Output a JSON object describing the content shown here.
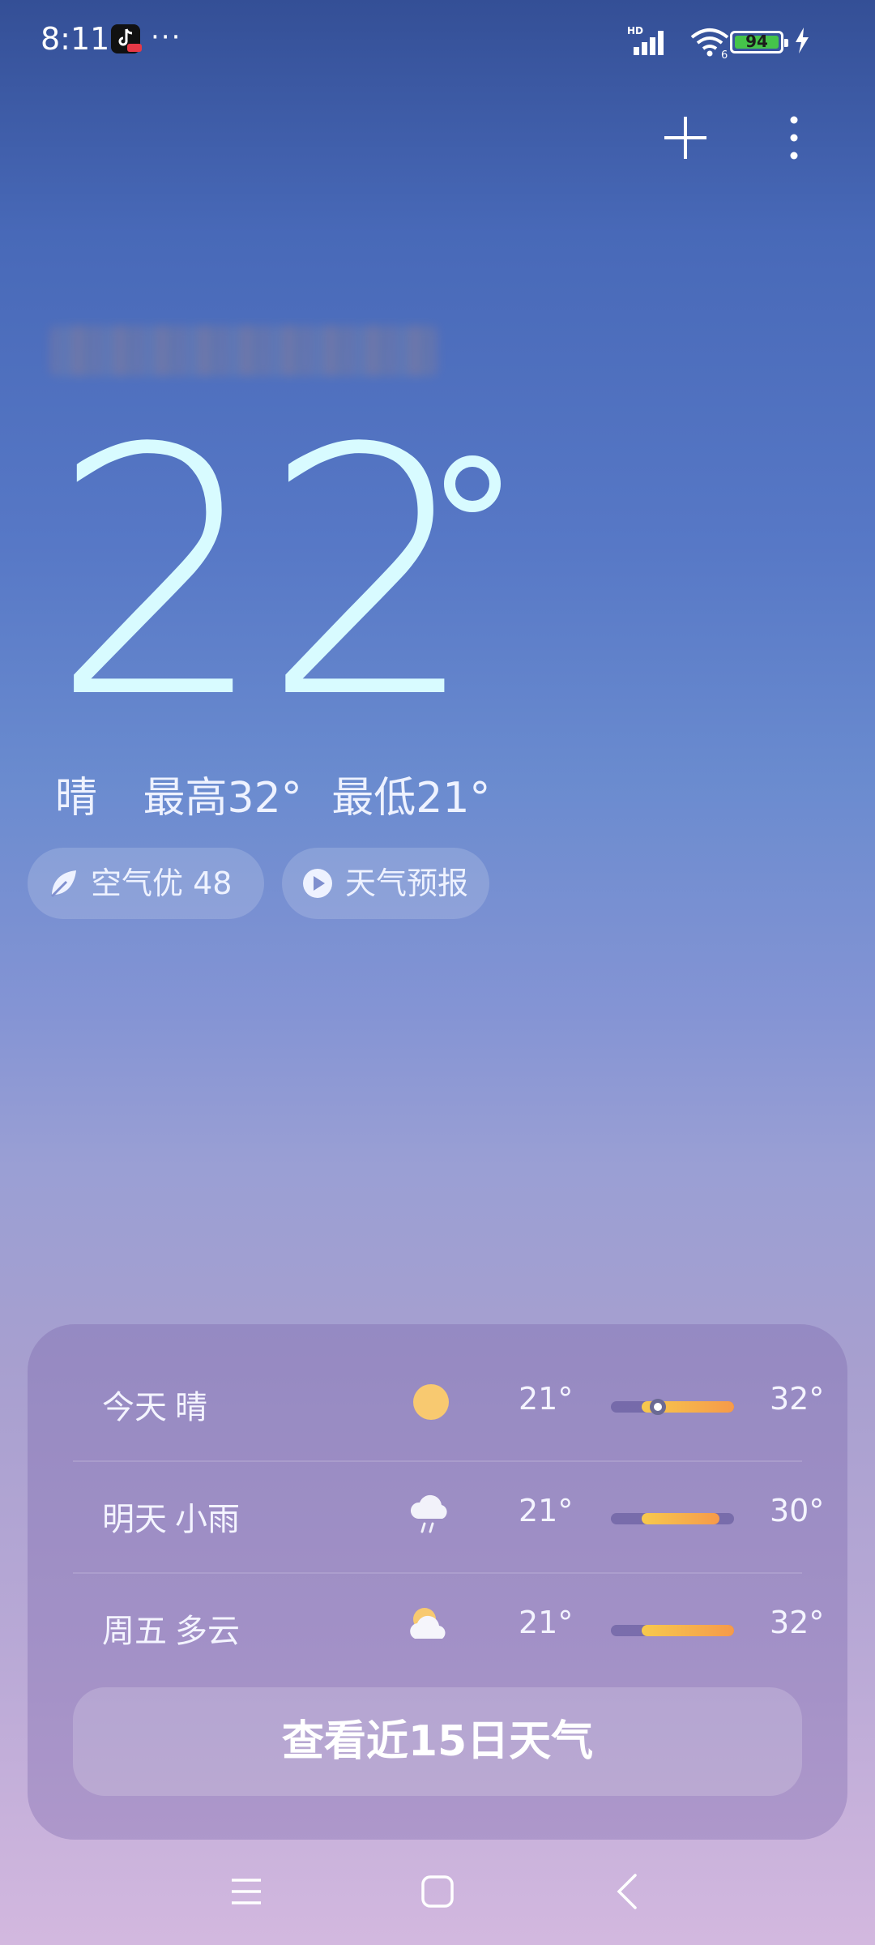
{
  "status_bar": {
    "time": "8:11",
    "more": "···",
    "battery": "94",
    "network_label": "HD",
    "wifi_label": "6"
  },
  "current": {
    "temperature": "22",
    "condition": "晴",
    "high": "最高32°",
    "low": "最低21°"
  },
  "pills": {
    "aqi": "空气优 48",
    "forecast": "天气预报"
  },
  "forecast": [
    {
      "day": "今天",
      "condition": "晴",
      "icon": "sun-icon",
      "low": "21°",
      "high": "32°",
      "bar_start": 0.25,
      "bar_end": 1.0,
      "now": 0.38
    },
    {
      "day": "明天",
      "condition": "小雨",
      "icon": "rain-cloud-icon",
      "low": "21°",
      "high": "30°",
      "bar_start": 0.25,
      "bar_end": 0.88
    },
    {
      "day": "周五",
      "condition": "多云",
      "icon": "partly-cloudy-icon",
      "low": "21°",
      "high": "32°",
      "bar_start": 0.25,
      "bar_end": 1.0
    }
  ],
  "view_15_days": "查看近15日天气",
  "colors": {
    "temp_text": "#d8fbff",
    "bar_warm": "#f7c94d",
    "bar_hot": "#f69a4a",
    "battery_green": "#45c34a"
  }
}
